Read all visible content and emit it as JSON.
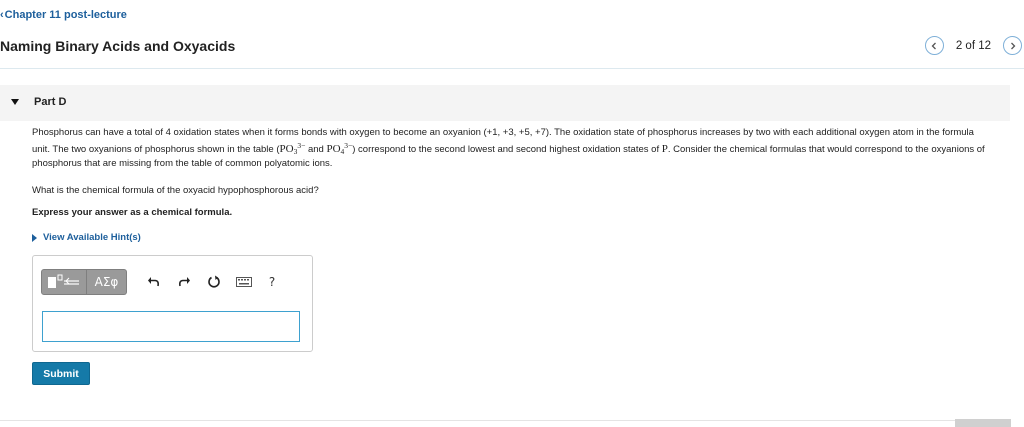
{
  "nav": {
    "back_label": "Chapter 11 post-lecture"
  },
  "header": {
    "title": "Naming Binary Acids and Oxyacids",
    "pager_text": "2 of 12"
  },
  "part": {
    "label": "Part D"
  },
  "problem": {
    "para_a": "Phosphorus can have a total of 4 oxidation states when it forms bonds with oxygen to become an oxyanion (+1, +3, +5, +7). The oxidation state of phosphorus increases by two with each additional oxygen atom in the formula unit. The two oxyanions of phosphorus shown in the table (",
    "f1_base": "PO",
    "f1_sub": "3",
    "f1_sup": "3−",
    "mid": " and ",
    "f2_base": "PO",
    "f2_sub": "4",
    "f2_sup": "3−",
    "para_b": ") correspond to the second lowest and second highest oxidation states of ",
    "element": "P",
    "para_c": ". Consider the chemical formulas that would correspond to the oxyanions of phosphorus that are missing from the table of common polyatomic ions.",
    "question": "What is the chemical formula of the oxyacid hypophosphorous acid?",
    "instruction": "Express your answer as a chemical formula.",
    "hint_label": "View Available Hint(s)"
  },
  "toolbar": {
    "greek_label": "ΑΣφ",
    "help_label": "?",
    "icons": [
      "templates-icon",
      "greek-letters-icon",
      "undo-icon",
      "redo-icon",
      "reset-icon",
      "keyboard-icon",
      "help-icon"
    ]
  },
  "answer": {
    "value": ""
  },
  "actions": {
    "submit_label": "Submit"
  },
  "colors": {
    "link": "#1d5f9c",
    "submit": "#157aa8",
    "input_border": "#3ea1cf",
    "part_header_bg": "#f4f4f4"
  }
}
